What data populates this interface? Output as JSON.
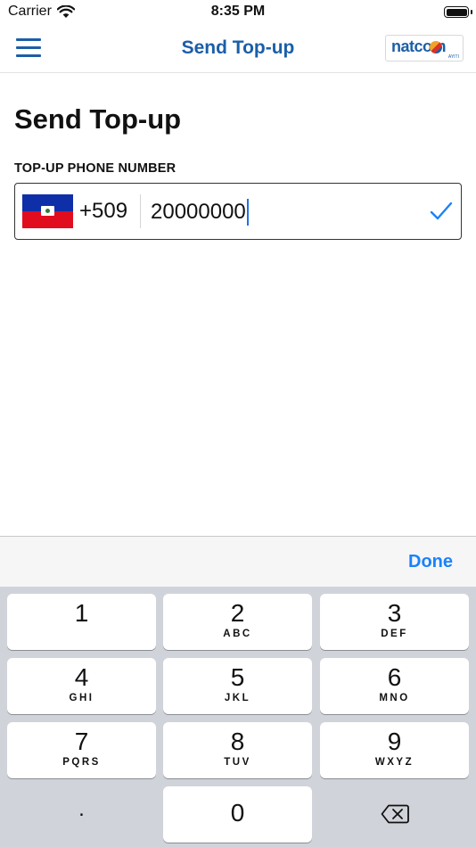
{
  "status_bar": {
    "carrier": "Carrier",
    "time": "8:35 PM"
  },
  "nav": {
    "title": "Send Top-up",
    "logo_text": "natcom",
    "logo_sub": "AYITI"
  },
  "form": {
    "title": "Send Top-up",
    "phone_label": "TOP-UP PHONE NUMBER",
    "dial_code": "+509",
    "phone_value": "20000000"
  },
  "keyboard": {
    "done_label": "Done",
    "keys": [
      {
        "digit": "1",
        "letters": ""
      },
      {
        "digit": "2",
        "letters": "ABC"
      },
      {
        "digit": "3",
        "letters": "DEF"
      },
      {
        "digit": "4",
        "letters": "GHI"
      },
      {
        "digit": "5",
        "letters": "JKL"
      },
      {
        "digit": "6",
        "letters": "MNO"
      },
      {
        "digit": "7",
        "letters": "PQRS"
      },
      {
        "digit": "8",
        "letters": "TUV"
      },
      {
        "digit": "9",
        "letters": "WXYZ"
      },
      {
        "digit": "0",
        "letters": ""
      }
    ],
    "decimal": "."
  },
  "colors": {
    "brand_blue": "#1b5ea8",
    "ios_blue": "#1a82fb"
  },
  "icons": {
    "menu": "hamburger-icon",
    "wifi": "wifi-icon",
    "battery": "battery-icon",
    "check": "checkmark-icon",
    "backspace": "backspace-icon",
    "flag": "haiti-flag-icon"
  }
}
